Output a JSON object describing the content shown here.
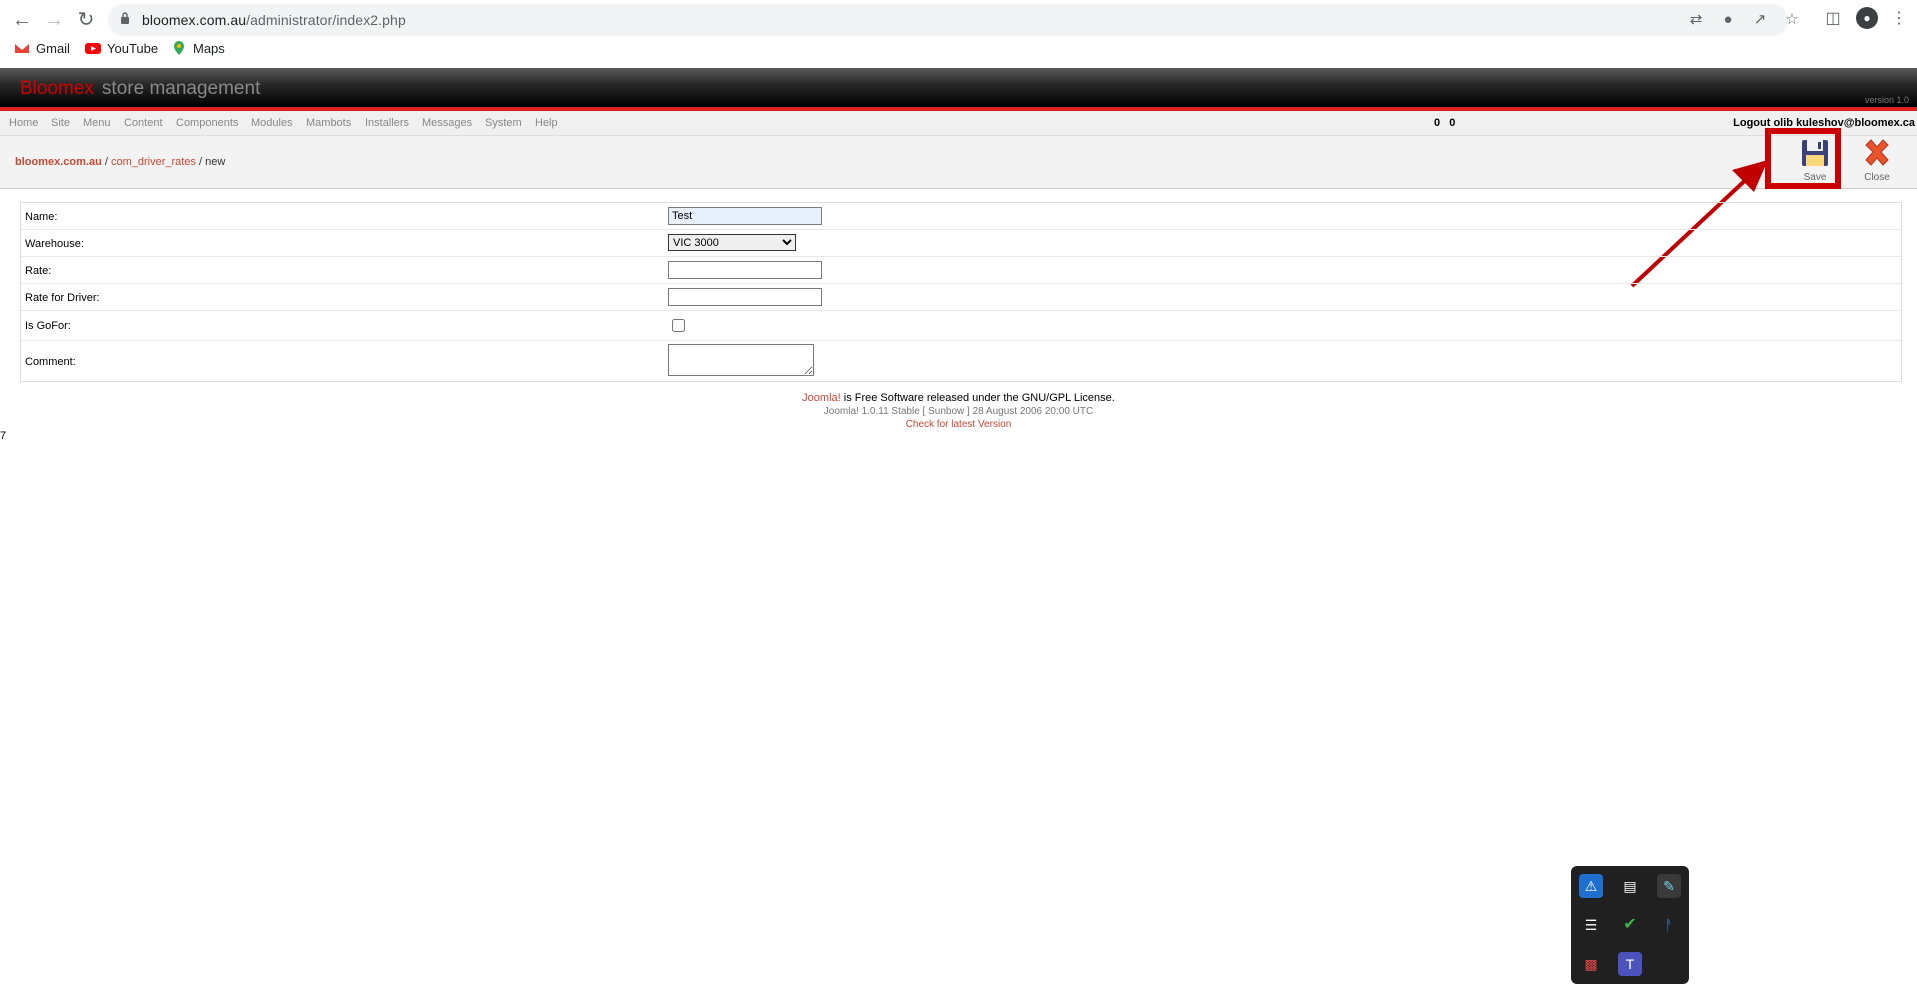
{
  "browser": {
    "url_host": "bloomex.com.au",
    "url_path": "/administrator/index2.php",
    "bookmarks": [
      {
        "label": "Gmail",
        "icon": "gmail-icon"
      },
      {
        "label": "YouTube",
        "icon": "youtube-icon"
      },
      {
        "label": "Maps",
        "icon": "maps-icon"
      }
    ]
  },
  "header": {
    "brand_red": "Bloomex",
    "brand_grey": "store management",
    "version": "version 1.0"
  },
  "menu": {
    "items": [
      "Home",
      "Site",
      "Menu",
      "Content",
      "Components",
      "Modules",
      "Mambots",
      "Installers",
      "Messages",
      "System",
      "Help"
    ],
    "counts": "0   0",
    "logout": "Logout olib kuleshov@bloomex.ca"
  },
  "pathway": {
    "site": "bloomex.com.au",
    "component": "com_driver_rates",
    "sep": " / ",
    "current": "new"
  },
  "toolbar": {
    "save_label": "Save",
    "close_label": "Close"
  },
  "form": {
    "name_label": "Name:",
    "name_value": "Test",
    "warehouse_label": "Warehouse:",
    "warehouse_value": "VIC 3000",
    "rate_label": "Rate:",
    "rate_driver_label": "Rate for Driver:",
    "gofor_label": "Is GoFor:",
    "comment_label": "Comment:"
  },
  "footer": {
    "joomla": "Joomla!",
    "license_text": " is Free Software released under the GNU/GPL License.",
    "version_line": "Joomla! 1.0.11 Stable [ Sunbow ] 28 August 2006 20:00 UTC",
    "check_link": "Check for latest Version"
  },
  "stray_text": "7",
  "colors": {
    "brand_red": "#d40000",
    "link_red": "#c64934",
    "highlight_red": "#c00000"
  }
}
